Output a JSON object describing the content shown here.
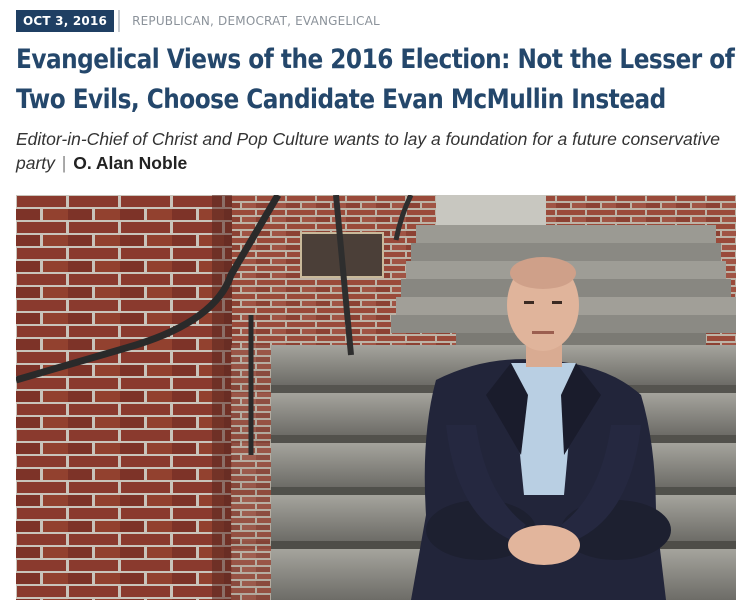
{
  "meta": {
    "date": "OCT 3, 2016",
    "categories": "REPUBLICAN, DEMOCRAT, EVANGELICAL"
  },
  "headline": "Evangelical Views of the 2016 Election: Not the Lesser of Two Evils, Choose Candidate Evan McMullin Instead",
  "subhead": {
    "dek": "Editor-in-Chief of Christ and Pop Culture wants to lay a foundation for a future conservative party",
    "separator": "|",
    "author": "O. Alan Noble"
  },
  "photo": {
    "subject": "man in dark suit seated on stone steps beside brick pillar",
    "colors": {
      "brick": "#8a3a2e",
      "stone": "#8d8c86",
      "suit": "#22253a",
      "shirt": "#b9cfe3"
    }
  },
  "colors": {
    "accent": "#1f3f63",
    "headline": "#24476b",
    "muted": "#8b929a"
  }
}
